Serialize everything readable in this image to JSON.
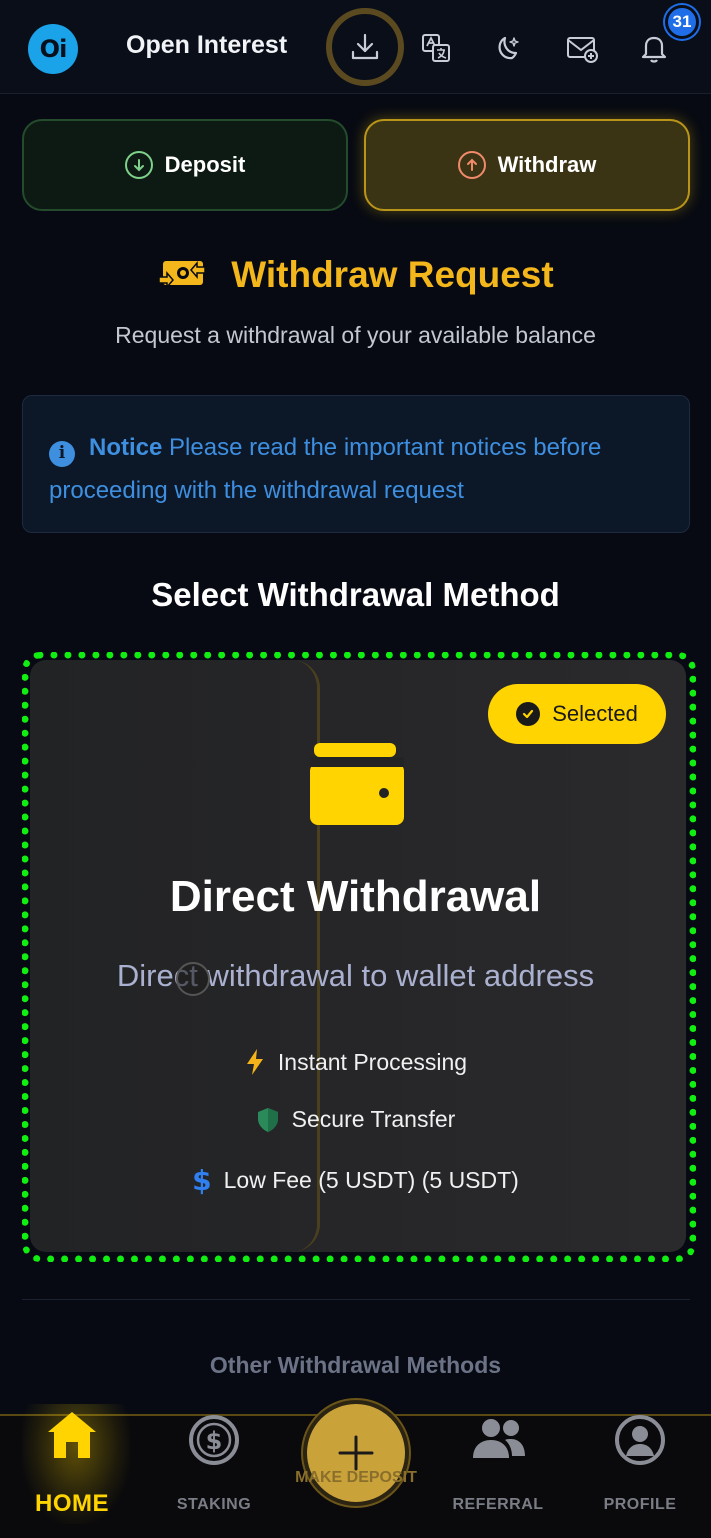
{
  "header": {
    "logo_text": "Oi",
    "title": "Open Interest",
    "notification_count": "31"
  },
  "tabs": {
    "deposit_label": "Deposit",
    "withdraw_label": "Withdraw"
  },
  "withdraw": {
    "title": "Withdraw Request",
    "subtitle": "Request a withdrawal of your available balance"
  },
  "notice": {
    "heading": "Notice",
    "text": "Please read the important notices before proceeding with the withdrawal request"
  },
  "methods": {
    "section_title": "Select Withdrawal Method",
    "selected_label": "Selected",
    "direct": {
      "title": "Direct Withdrawal",
      "subtitle": "Direct withdrawal to wallet address",
      "features": [
        "Instant Processing",
        "Secure Transfer",
        "Low Fee (5 USDT) (5 USDT)"
      ]
    },
    "other_title": "Other Withdrawal Methods"
  },
  "bottom_nav": {
    "home": "HOME",
    "staking": "STAKING",
    "make_deposit": "MAKE DEPOSIT",
    "referral": "REFERRAL",
    "profile": "PROFILE"
  },
  "colors": {
    "accent": "#ffd400",
    "withdraw_gold": "#f3b61b",
    "deposit_green": "#244b2c",
    "notice_blue": "#3e8fe0",
    "selection_outline": "#11ee11"
  },
  "icons": {
    "download": "download-icon",
    "translate": "translate-icon",
    "theme": "moon-stars-icon",
    "mail": "mail-add-icon",
    "bell": "bell-icon"
  }
}
